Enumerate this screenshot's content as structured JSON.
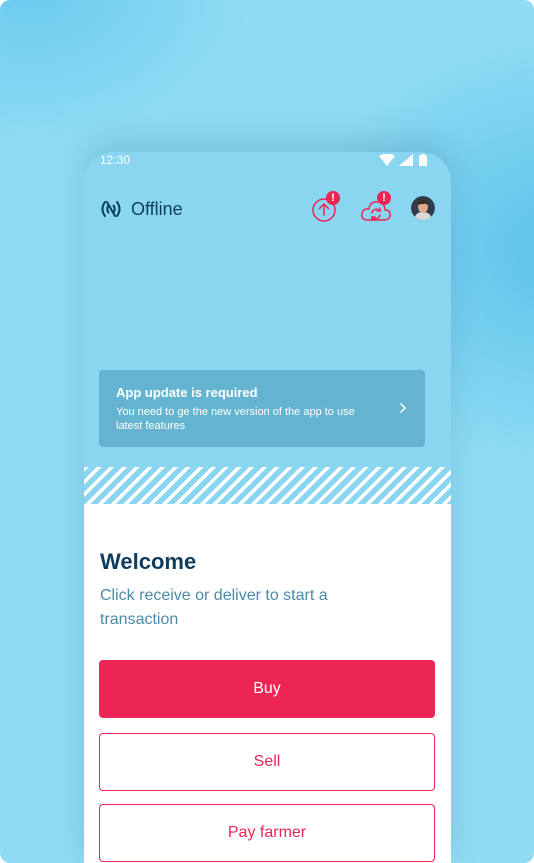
{
  "status_bar": {
    "time": "12:30",
    "icons": [
      "wifi-icon",
      "signal-icon",
      "battery-icon"
    ]
  },
  "header": {
    "connection_status": "Offline",
    "connection_icon": "offline-broadcast-icon",
    "upload_badge": "!",
    "sync_badge": "!",
    "avatar_icon": "user-avatar"
  },
  "update_banner": {
    "title": "App update is required",
    "description": "You need to ge the new version of the app to use latest features"
  },
  "welcome": {
    "title": "Welcome",
    "subtitle": "Click receive or deliver to start a transaction"
  },
  "actions": {
    "buy_label": "Buy",
    "sell_label": "Sell",
    "pay_farmer_label": "Pay farmer"
  },
  "colors": {
    "background": "#8fdcf4",
    "phone_background": "#8ad6f1",
    "banner": "#64b4d1",
    "accent": "#ed2555",
    "title": "#0f3d5c",
    "subtitle": "#4a8aa8"
  }
}
